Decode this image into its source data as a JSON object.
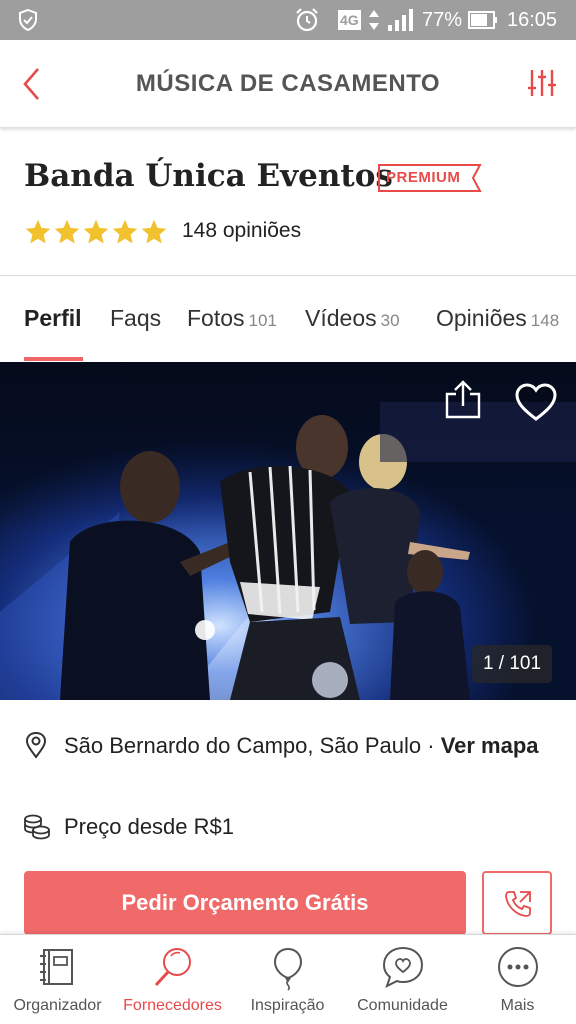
{
  "status_bar": {
    "network": "4G",
    "battery": "77%",
    "time": "16:05"
  },
  "header": {
    "title": "MÚSICA DE CASAMENTO"
  },
  "vendor": {
    "name": "Banda Única Eventos",
    "badge": "PREMIUM",
    "rating": 5,
    "reviews": "148 opiniões"
  },
  "tabs": [
    {
      "label": "Perfil",
      "count": ""
    },
    {
      "label": "Faqs",
      "count": ""
    },
    {
      "label": "Fotos",
      "count": "101"
    },
    {
      "label": "Vídeos",
      "count": "30"
    },
    {
      "label": "Opiniões",
      "count": "148"
    }
  ],
  "photo": {
    "counter": "1 / 101"
  },
  "details": {
    "location": "São Bernardo do Campo, São Paulo · ",
    "map_link": "Ver mapa",
    "price": "Preço desde R$1"
  },
  "cta": {
    "label": "Pedir Orçamento Grátis"
  },
  "bottom_nav": [
    {
      "label": "Organizador",
      "icon": "notebook-icon"
    },
    {
      "label": "Fornecedores",
      "icon": "search-icon"
    },
    {
      "label": "Inspiração",
      "icon": "balloon-icon"
    },
    {
      "label": "Comunidade",
      "icon": "chat-heart-icon"
    },
    {
      "label": "Mais",
      "icon": "more-icon"
    }
  ],
  "colors": {
    "accent": "#f16a6a",
    "star": "#f2c12e",
    "status_bar": "#9e9e9e"
  }
}
